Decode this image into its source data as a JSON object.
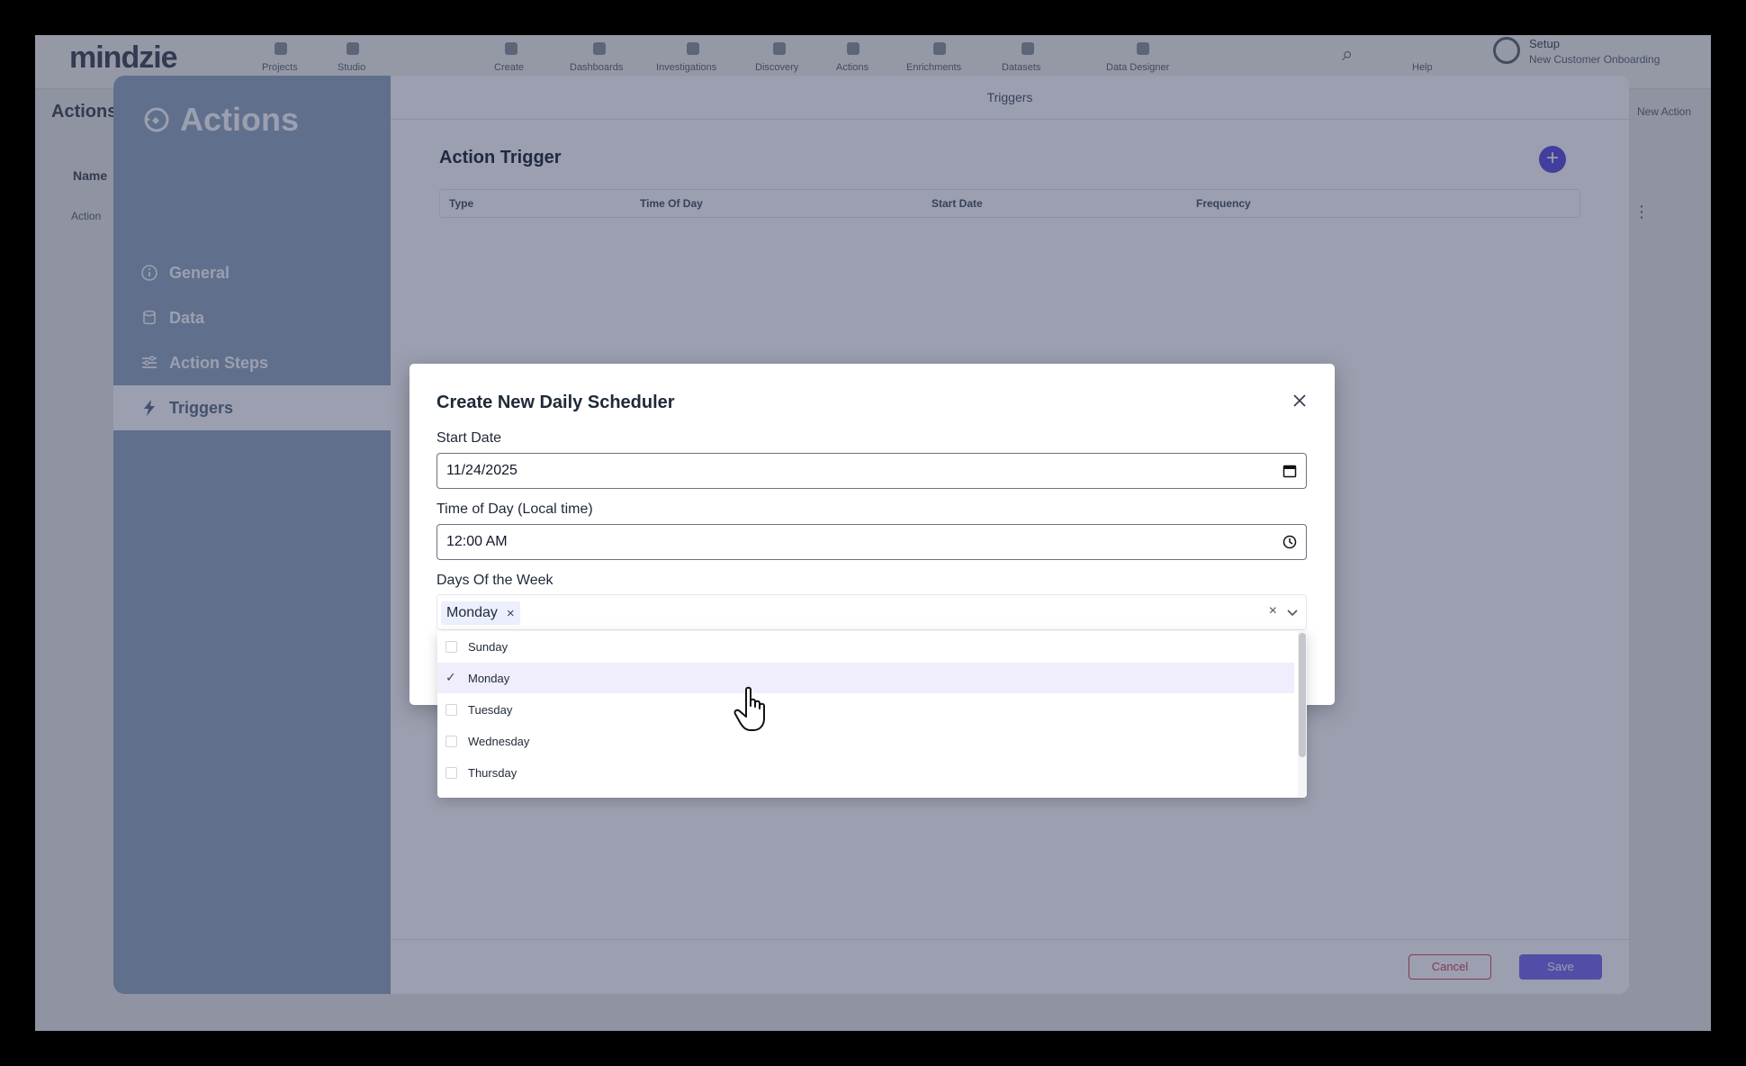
{
  "app": {
    "logo": "mindzie",
    "nav": [
      "Projects",
      "Studio",
      "Create",
      "Dashboards",
      "Investigations",
      "Discovery",
      "Actions",
      "Enrichments",
      "Datasets",
      "Data Designer"
    ],
    "help_label": "Help",
    "user_name": "Setup",
    "user_org": "New Customer Onboarding",
    "bg_title": "Actions",
    "bg_new_action": "New Action",
    "bg_name_header": "Name",
    "bg_row_text": "Action"
  },
  "panel": {
    "title": "Actions",
    "nav": [
      {
        "label": "General",
        "icon": "info-icon"
      },
      {
        "label": "Data",
        "icon": "database-icon"
      },
      {
        "label": "Action Steps",
        "icon": "steps-icon"
      },
      {
        "label": "Triggers",
        "icon": "lightning-icon",
        "active": true
      }
    ],
    "tab_title": "Triggers",
    "section_title": "Action Trigger",
    "columns": [
      "Type",
      "Time Of Day",
      "Start Date",
      "Frequency"
    ],
    "cancel_label": "Cancel",
    "save_label": "Save"
  },
  "modal": {
    "title": "Create New Daily Scheduler",
    "start_date_label": "Start Date",
    "start_date_value": "11/24/2025",
    "time_label": "Time of Day (Local time)",
    "time_value": "12:00  AM",
    "days_label": "Days Of the Week",
    "selected_tag": "Monday",
    "tag_remove": "×",
    "clear_all": "×"
  },
  "dropdown": {
    "options": [
      {
        "label": "Sunday",
        "checked": false
      },
      {
        "label": "Monday",
        "checked": true
      },
      {
        "label": "Tuesday",
        "checked": false
      },
      {
        "label": "Wednesday",
        "checked": false
      },
      {
        "label": "Thursday",
        "checked": false
      }
    ]
  },
  "colors": {
    "sidebar": "#94a8be",
    "accent": "#5b4fe0",
    "cancel": "#d3455a"
  }
}
